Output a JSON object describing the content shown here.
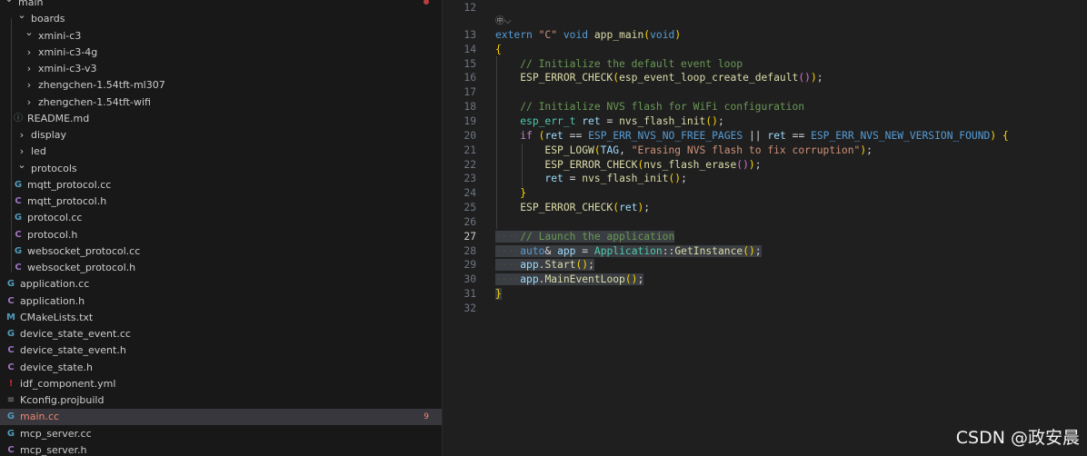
{
  "explorer": {
    "items": [
      {
        "label": "main",
        "type": "folder-open",
        "depth": 0,
        "status": "modified-dot"
      },
      {
        "label": "boards",
        "type": "folder-open",
        "depth": 1
      },
      {
        "label": "xmini-c3",
        "type": "folder-open",
        "depth": 2
      },
      {
        "label": "xmini-c3-4g",
        "type": "folder",
        "depth": 2
      },
      {
        "label": "xmini-c3-v3",
        "type": "folder",
        "depth": 2
      },
      {
        "label": "zhengchen-1.54tft-ml307",
        "type": "folder",
        "depth": 2
      },
      {
        "label": "zhengchen-1.54tft-wifi",
        "type": "folder",
        "depth": 2
      },
      {
        "label": "README.md",
        "type": "file",
        "icon": "info-icon",
        "depth": 2
      },
      {
        "label": "display",
        "type": "folder",
        "depth": 1
      },
      {
        "label": "led",
        "type": "folder",
        "depth": 1
      },
      {
        "label": "protocols",
        "type": "folder-open",
        "depth": 1
      },
      {
        "label": "mqtt_protocol.cc",
        "type": "file",
        "icon": "cpp-icon",
        "depth": 2
      },
      {
        "label": "mqtt_protocol.h",
        "type": "file",
        "icon": "c-header-icon",
        "depth": 2
      },
      {
        "label": "protocol.cc",
        "type": "file",
        "icon": "cpp-icon",
        "depth": 2
      },
      {
        "label": "protocol.h",
        "type": "file",
        "icon": "c-header-icon",
        "depth": 2
      },
      {
        "label": "websocket_protocol.cc",
        "type": "file",
        "icon": "cpp-icon",
        "depth": 2
      },
      {
        "label": "websocket_protocol.h",
        "type": "file",
        "icon": "c-header-icon",
        "depth": 2
      },
      {
        "label": "application.cc",
        "type": "file",
        "icon": "cpp-icon",
        "depth": 1
      },
      {
        "label": "application.h",
        "type": "file",
        "icon": "c-header-icon",
        "depth": 1
      },
      {
        "label": "CMakeLists.txt",
        "type": "file",
        "icon": "cmake-icon",
        "depth": 1
      },
      {
        "label": "device_state_event.cc",
        "type": "file",
        "icon": "cpp-icon",
        "depth": 1
      },
      {
        "label": "device_state_event.h",
        "type": "file",
        "icon": "c-header-icon",
        "depth": 1
      },
      {
        "label": "device_state.h",
        "type": "file",
        "icon": "c-header-icon",
        "depth": 1
      },
      {
        "label": "idf_component.yml",
        "type": "file",
        "icon": "yaml-icon",
        "depth": 1
      },
      {
        "label": "Kconfig.projbuild",
        "type": "file",
        "icon": "kconfig-icon",
        "depth": 1
      },
      {
        "label": "main.cc",
        "type": "file",
        "icon": "cpp-icon",
        "depth": 1,
        "selected": true,
        "modified": true,
        "badge": "9"
      },
      {
        "label": "mcp_server.cc",
        "type": "file",
        "icon": "cpp-icon",
        "depth": 1
      },
      {
        "label": "mcp_server.h",
        "type": "file",
        "icon": "c-header-icon",
        "depth": 1
      }
    ]
  },
  "editor": {
    "codelens_glyph": "㊥",
    "active_line": "27",
    "lines": [
      {
        "n": "12",
        "t": ""
      },
      {
        "n": "13",
        "t": "extern \"C\" void app_main(void)"
      },
      {
        "n": "14",
        "t": "{"
      },
      {
        "n": "15",
        "t": "    // Initialize the default event loop"
      },
      {
        "n": "16",
        "t": "    ESP_ERROR_CHECK(esp_event_loop_create_default());"
      },
      {
        "n": "17",
        "t": ""
      },
      {
        "n": "18",
        "t": "    // Initialize NVS flash for WiFi configuration"
      },
      {
        "n": "19",
        "t": "    esp_err_t ret = nvs_flash_init();"
      },
      {
        "n": "20",
        "t": "    if (ret == ESP_ERR_NVS_NO_FREE_PAGES || ret == ESP_ERR_NVS_NEW_VERSION_FOUND) {"
      },
      {
        "n": "21",
        "t": "        ESP_LOGW(TAG, \"Erasing NVS flash to fix corruption\");"
      },
      {
        "n": "22",
        "t": "        ESP_ERROR_CHECK(nvs_flash_erase());"
      },
      {
        "n": "23",
        "t": "        ret = nvs_flash_init();"
      },
      {
        "n": "24",
        "t": "    }"
      },
      {
        "n": "25",
        "t": "    ESP_ERROR_CHECK(ret);"
      },
      {
        "n": "26",
        "t": ""
      },
      {
        "n": "27",
        "t": "    // Launch the application"
      },
      {
        "n": "28",
        "t": "    auto& app = Application::GetInstance();"
      },
      {
        "n": "29",
        "t": "    app.Start();"
      },
      {
        "n": "30",
        "t": "    app.MainEventLoop();"
      },
      {
        "n": "31",
        "t": "}"
      },
      {
        "n": "32",
        "t": ""
      }
    ]
  },
  "watermark": "CSDN @政安晨",
  "colors": {
    "sidebar_bg": "#181818",
    "editor_bg": "#1f1f1f",
    "selection": "#3a3d41",
    "modified": "#f48771"
  }
}
